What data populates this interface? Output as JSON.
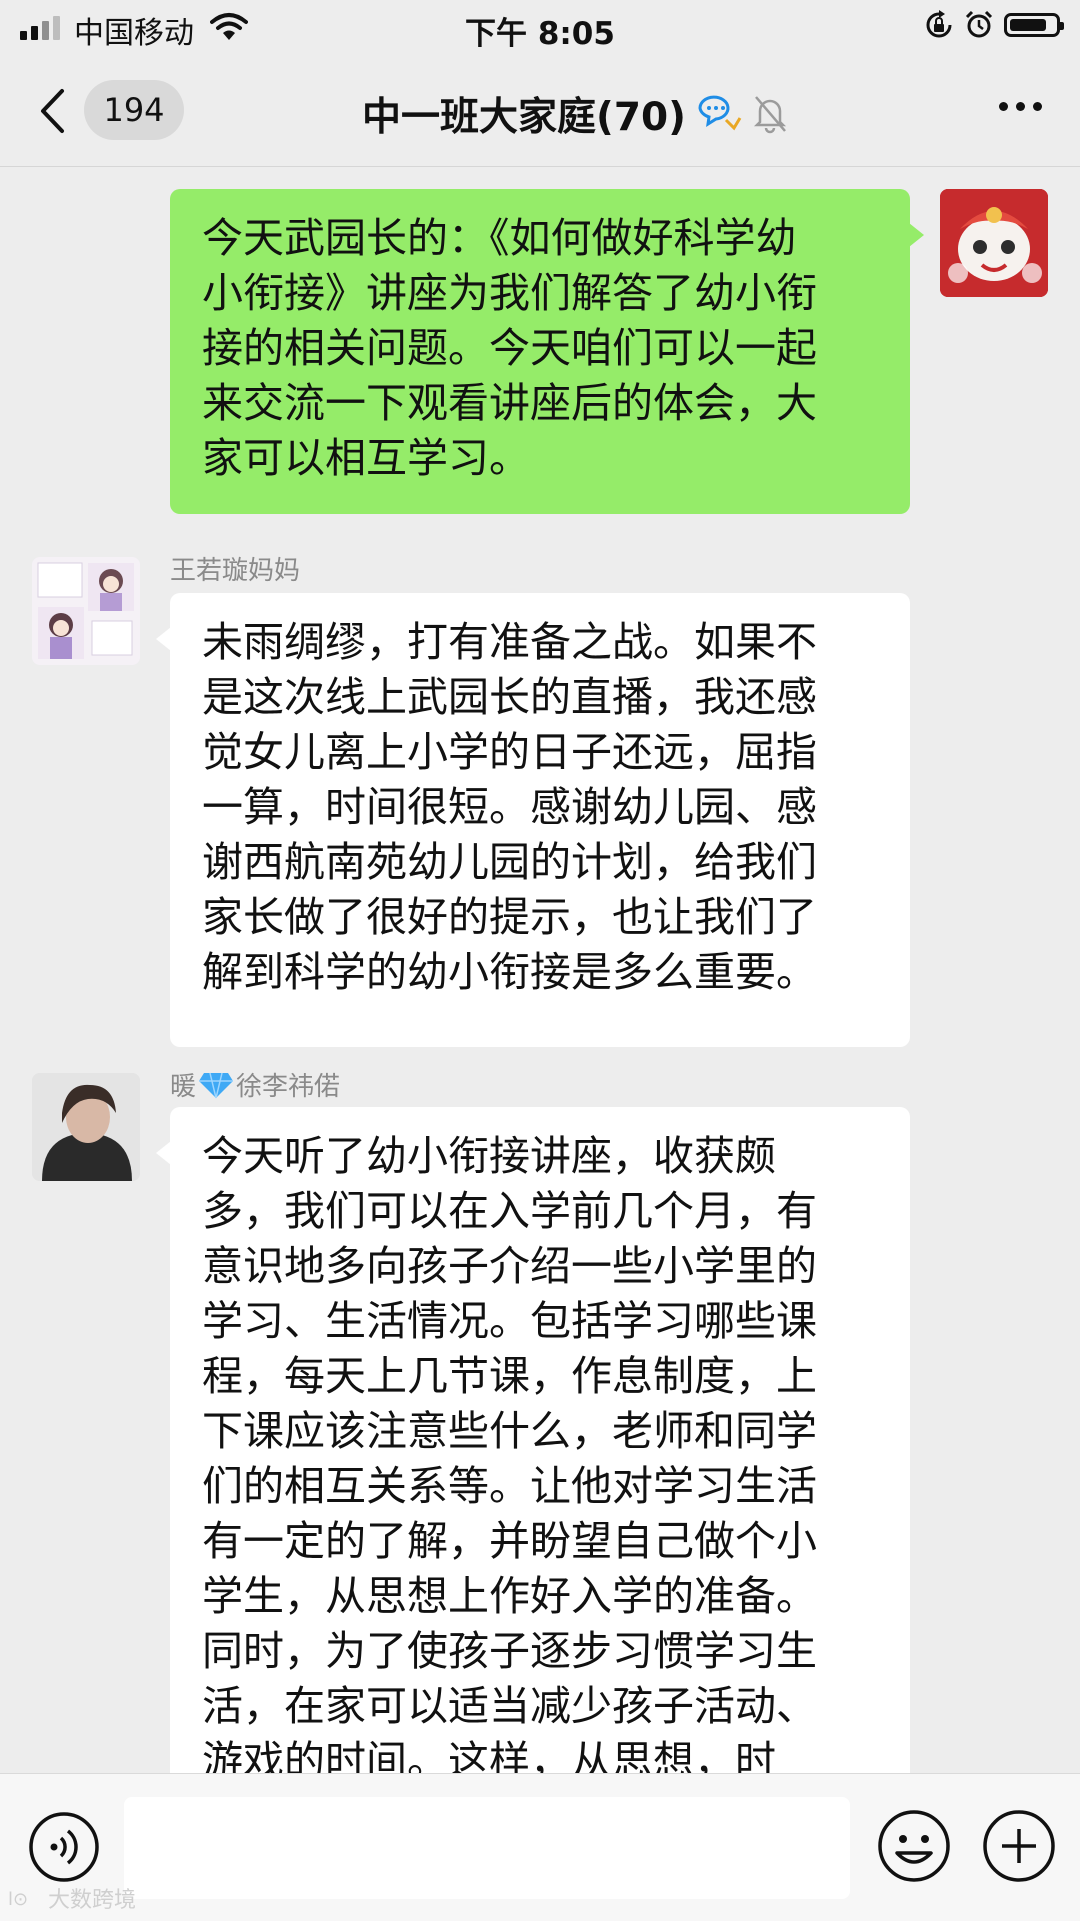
{
  "status_bar": {
    "carrier": "中国移动",
    "time": "下午 8:05"
  },
  "nav": {
    "unread_count": "194",
    "title": "中一班大家庭(70)"
  },
  "messages": [
    {
      "direction": "outgoing",
      "text": "今天武园长的：《如何做好科学幼\n小衔接》讲座为我们解答了幼小衔\n接的相关问题。今天咱们可以一起\n来交流一下观看讲座后的体会，大\n家可以相互学习。"
    },
    {
      "direction": "incoming",
      "sender": "王若璇妈妈",
      "text": "未雨绸缪，打有准备之战。如果不\n是这次线上武园长的直播，我还感\n觉女儿离上小学的日子还远，屈指\n一算，时间很短。感谢幼儿园、感\n谢西航南苑幼儿园的计划，给我们\n家长做了很好的提示，也让我们了\n解到科学的幼小衔接是多么重要。"
    },
    {
      "direction": "incoming",
      "sender_prefix": "暖",
      "sender_name": "徐李祎偌",
      "sender_emoji_icon": "diamond-icon",
      "text": "今天听了幼小衔接讲座，收获颇\n多，我们可以在入学前几个月，有\n意识地多向孩子介绍一些小学里的\n学习、生活情况。包括学习哪些课\n程，每天上几节课，作息制度，上\n下课应该注意些什么，老师和同学\n们的相互关系等。让他对学习生活\n有一定的了解，并盼望自己做个小\n学生，从思想上作好入学的准备。\n同时，为了使孩子逐步习惯学习生\n活，在家可以适当减少孩子活动、\n游戏的时间。这样，从思想，时"
    }
  ],
  "input_bar": {
    "text_value": ""
  },
  "watermark": {
    "text": "大数跨境"
  },
  "colors": {
    "background": "#ededed",
    "outgoing_bubble": "#95ec69",
    "incoming_bubble": "#ffffff",
    "sender_name": "#8a8a8a",
    "wechat_blue": "#1f8de6"
  }
}
